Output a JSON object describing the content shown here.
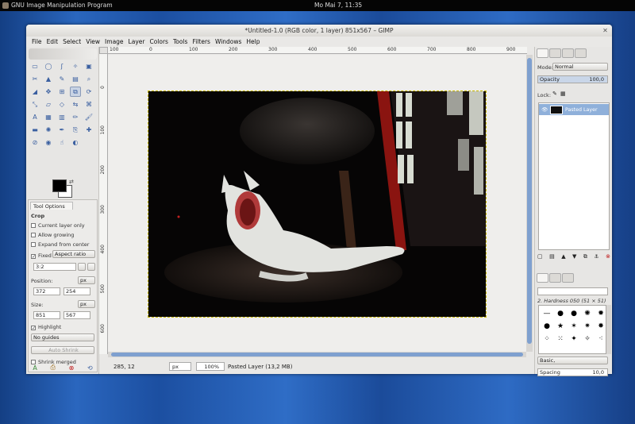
{
  "topbar": {
    "app_name": "GNU Image Manipulation Program",
    "clock": "Mo Mai  7, 11:35"
  },
  "window": {
    "title": "*Untitled-1.0 (RGB color, 1 layer) 851x567 – GIMP",
    "close_glyph": "✕"
  },
  "menu": [
    "File",
    "Edit",
    "Select",
    "View",
    "Image",
    "Layer",
    "Colors",
    "Tools",
    "Filters",
    "Windows",
    "Help"
  ],
  "tools": [
    "rect-select",
    "ellipse-select",
    "free-select",
    "fuzzy-select",
    "by-color-select",
    "scissors",
    "foreground-select",
    "paths",
    "color-picker",
    "zoom",
    "measure",
    "move",
    "align",
    "crop",
    "rotate",
    "scale",
    "shear",
    "perspective",
    "flip",
    "cage",
    "text",
    "bucket-fill",
    "blend",
    "pencil",
    "paintbrush",
    "eraser",
    "airbrush",
    "ink",
    "clone",
    "heal",
    "perspective-clone",
    "blur",
    "smudge",
    "dodge-burn"
  ],
  "tool_glyphs": [
    "▭",
    "◯",
    "ʃ",
    "✧",
    "▣",
    "✂",
    "▲",
    "✎",
    "▤",
    "⌕",
    "◢",
    "✥",
    "⊞",
    "⧉",
    "⟳",
    "⤡",
    "▱",
    "◇",
    "⇆",
    "⌘",
    "A",
    "▦",
    "▥",
    "✏",
    "🖌",
    "▬",
    "✺",
    "✒",
    "⎘",
    "✚",
    "⊘",
    "◉",
    "☝",
    "◐"
  ],
  "colors": {
    "fg": "#000000",
    "bg": "#ffffff",
    "accent": "#8fb0da",
    "scroll": "#7fa0cf"
  },
  "tool_options": {
    "tab": "Tool Options",
    "section": "Crop",
    "current_layer_only": "Current layer only",
    "allow_growing": "Allow growing",
    "expand_from_center": "Expand from center",
    "fixed_label": "Fixed",
    "fixed_mode": "Aspect ratio",
    "ratio": "3:2",
    "position_label": "Position:",
    "position_unit": "px",
    "position_x": "372",
    "position_y": "254",
    "size_label": "Size:",
    "size_unit": "px",
    "size_w": "851",
    "size_h": "567",
    "highlight": "Highlight",
    "guides": "No guides",
    "auto_shrink": "Auto Shrink",
    "shrink_merged": "Shrink merged"
  },
  "ruler": {
    "top": [
      "100",
      "0",
      "100",
      "200",
      "300",
      "400",
      "500",
      "600",
      "700",
      "800",
      "900"
    ],
    "left": [
      "0",
      "100",
      "200",
      "300",
      "400",
      "500",
      "600"
    ]
  },
  "status": {
    "coords": "285, 12",
    "unit": "px",
    "zoom": "100%",
    "message": "Pasted Layer (13,2 MB)"
  },
  "layers": {
    "mode_label": "Mode:",
    "mode": "Normal",
    "opacity_label": "Opacity",
    "opacity": "100,0",
    "lock_label": "Lock:",
    "layer_name": "Pasted Layer"
  },
  "brushes": {
    "filter_placeholder": "",
    "current": "2. Hardness 050 (51 × 51)",
    "preset": "Basic,",
    "spacing_label": "Spacing",
    "spacing": "10,0"
  }
}
